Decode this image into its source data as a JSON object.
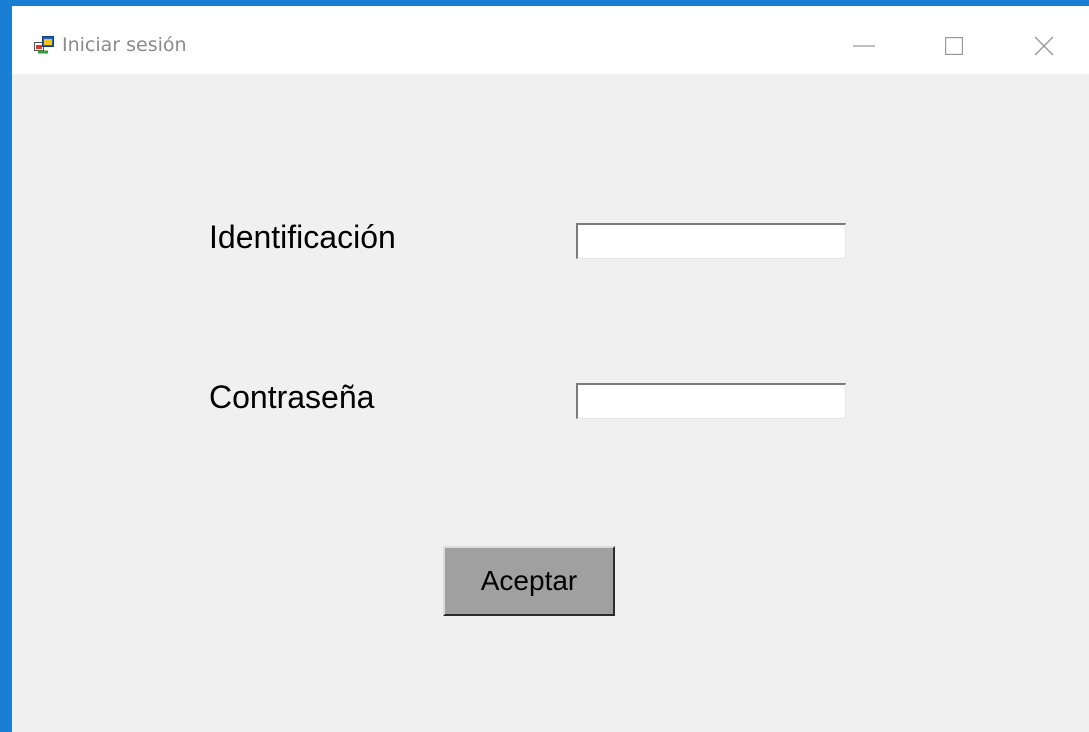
{
  "window": {
    "title": "Iniciar sesión",
    "icon": "winforms-app-icon",
    "controls": {
      "minimize_icon": "minimize-icon",
      "maximize_icon": "maximize-icon",
      "close_icon": "close-icon"
    },
    "colors": {
      "frame": "#1a7fd4",
      "client_bg": "#f0f0f0",
      "button_bg": "#a0a0a0"
    }
  },
  "form": {
    "identification_label": "Identificación",
    "identification_value": "",
    "password_label": "Contraseña",
    "password_value": "",
    "accept_label": "Aceptar"
  }
}
